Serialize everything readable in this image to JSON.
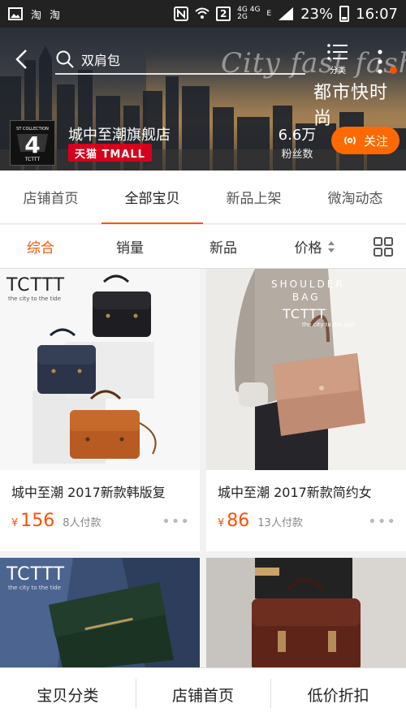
{
  "status_bar": {
    "app_labels": [
      "淘",
      "淘"
    ],
    "network_top": "4G 4G",
    "network_bottom": "2G",
    "sim_label": "2",
    "signal_label": "E",
    "battery": "23%",
    "time": "16:07"
  },
  "header": {
    "search_text": "双肩包",
    "menu_label": "分类",
    "banner_script": "City fast fashion",
    "banner_cn": "都市快时尚",
    "store_name": "城中至潮旗舰店",
    "tmall_badge": "天猫 TMALL",
    "fans_count": "6.6万",
    "fans_label": "粉丝数",
    "follow_label": "关注",
    "logo_text": "4",
    "logo_top": "ST COLLECTION",
    "logo_bottom": "TCTTT"
  },
  "tabs": [
    {
      "label": "店铺首页",
      "active": false
    },
    {
      "label": "全部宝贝",
      "active": true
    },
    {
      "label": "新品上架",
      "active": false
    },
    {
      "label": "微淘动态",
      "active": false
    }
  ],
  "sort_options": [
    {
      "label": "综合",
      "active": true
    },
    {
      "label": "销量",
      "active": false
    },
    {
      "label": "新品",
      "active": false
    },
    {
      "label": "价格",
      "active": false
    }
  ],
  "products": [
    {
      "title": "城中至潮 2017新款韩版复",
      "price_symbol": "¥",
      "price": "156",
      "sold": "8人付款",
      "brand": "TCTTT",
      "brand_sub": "the city to the tide"
    },
    {
      "title": "城中至潮 2017新款简约女",
      "price_symbol": "¥",
      "price": "86",
      "sold": "13人付款",
      "brand": "TCTTT",
      "brand_sub": "the city to the tide",
      "overlay_1": "SHOULDER",
      "overlay_2": "BAG"
    },
    {
      "brand": "TCTTT",
      "brand_sub": "the city to the tide"
    },
    {}
  ],
  "bottom_nav": [
    {
      "label": "宝贝分类"
    },
    {
      "label": "店铺首页"
    },
    {
      "label": "低价折扣"
    }
  ],
  "colors": {
    "accent": "#ff5000",
    "follow": "#ff6a00",
    "tmall": "#d6001c"
  }
}
